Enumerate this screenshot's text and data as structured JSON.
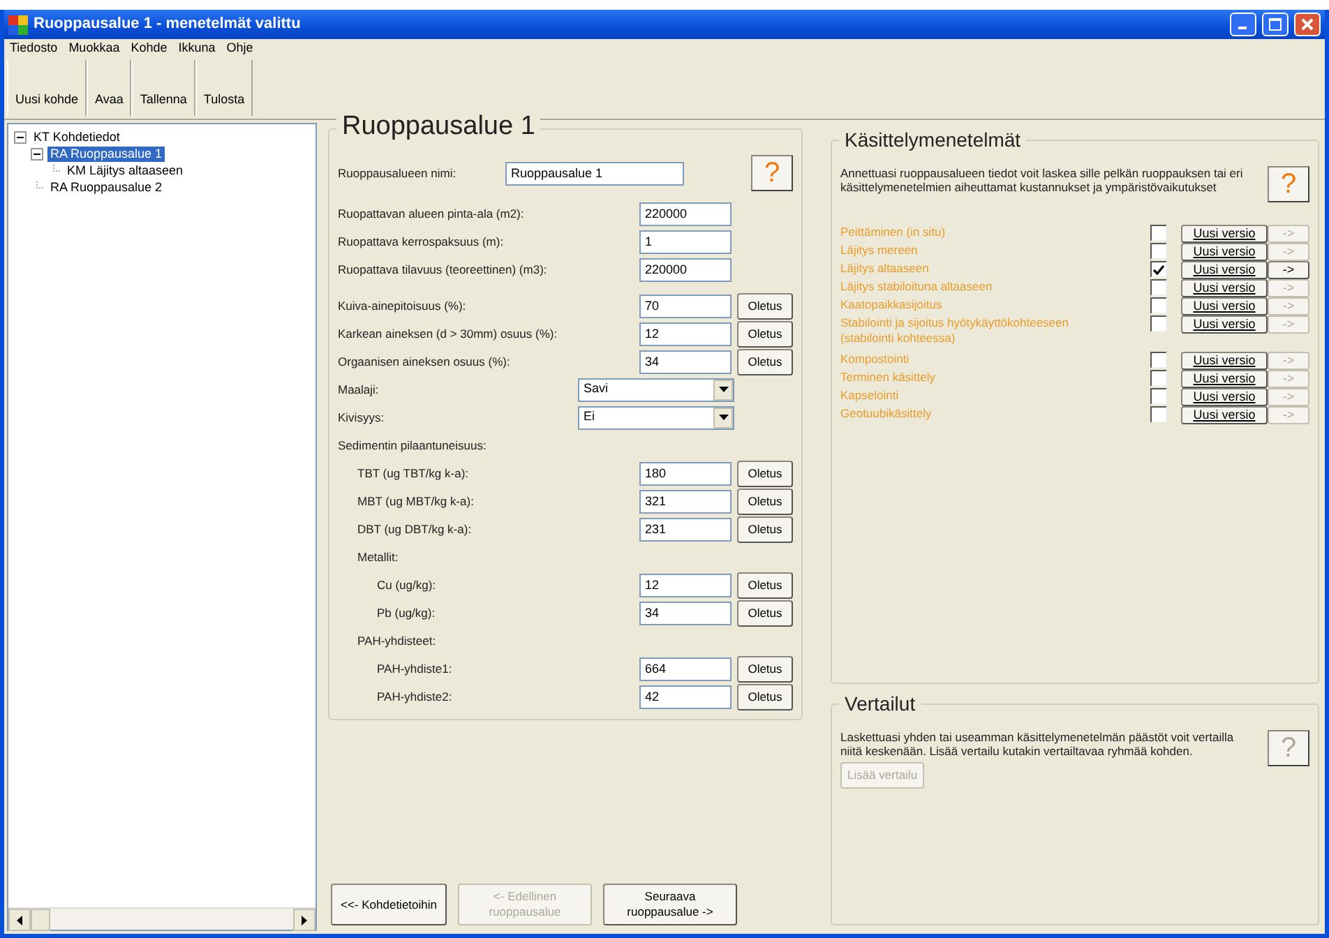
{
  "window": {
    "title": "Ruoppausalue 1 - menetelmät valittu"
  },
  "menu": [
    "Tiedosto",
    "Muokkaa",
    "Kohde",
    "Ikkuna",
    "Ohje"
  ],
  "toolbar": [
    "Uusi kohde",
    "Avaa",
    "Tallenna",
    "Tulosta"
  ],
  "tree": [
    {
      "label": "KT  Kohdetiedot",
      "expanded": true,
      "selected": false,
      "children": [
        {
          "label": "RA  Ruoppausalue 1",
          "expanded": true,
          "selected": true,
          "children": [
            {
              "label": "KM  Läjitys altaaseen",
              "selected": false
            }
          ]
        },
        {
          "label": "RA  Ruoppausalue 2",
          "selected": false
        }
      ]
    }
  ],
  "form": {
    "title": "Ruoppausalue 1",
    "help_button": {
      "label": "?",
      "disabled": false
    },
    "rows": [
      {
        "kind": "text",
        "label": "Ruoppausalueen nimi:",
        "value": "Ruoppausalue 1"
      },
      {
        "kind": "gap"
      },
      {
        "kind": "number",
        "label": "Ruopattavan alueen pinta-ala (m2):",
        "value": "220000"
      },
      {
        "kind": "number",
        "label": "Ruopattava kerrospaksuus (m):",
        "value": "1"
      },
      {
        "kind": "number",
        "label": "Ruopattava tilavuus (teoreettinen) (m3):",
        "value": "220000"
      },
      {
        "kind": "gap"
      },
      {
        "kind": "number",
        "label": "Kuiva-ainepitoisuus (%):",
        "value": "70",
        "button": "Oletus"
      },
      {
        "kind": "number",
        "label": "Karkean aineksen (d > 30mm) osuus (%):",
        "value": "12",
        "button": "Oletus"
      },
      {
        "kind": "number",
        "label": "Orgaanisen aineksen osuus (%):",
        "value": "34",
        "button": "Oletus"
      },
      {
        "kind": "select",
        "label": "Maalaji:",
        "value": "Savi"
      },
      {
        "kind": "select",
        "label": "Kivisyys:",
        "value": "Ei"
      },
      {
        "kind": "group",
        "label": "Sedimentin pilaantuneisuus:",
        "children": [
          {
            "kind": "number",
            "label": "TBT (ug TBT/kg k-a):",
            "value": "180",
            "button": "Oletus"
          },
          {
            "kind": "number",
            "label": "MBT (ug MBT/kg k-a):",
            "value": "321",
            "button": "Oletus"
          },
          {
            "kind": "number",
            "label": "DBT (ug DBT/kg k-a):",
            "value": "231",
            "button": "Oletus"
          },
          {
            "kind": "group",
            "label": "Metallit:",
            "children": [
              {
                "kind": "number",
                "label": "Cu (ug/kg):",
                "value": "12",
                "button": "Oletus"
              },
              {
                "kind": "number",
                "label": "Pb (ug/kg):",
                "value": "34",
                "button": "Oletus"
              }
            ]
          },
          {
            "kind": "group",
            "label": "PAH-yhdisteet:",
            "children": [
              {
                "kind": "number",
                "label": "PAH-yhdiste1:",
                "value": "664",
                "button": "Oletus"
              },
              {
                "kind": "number",
                "label": "PAH-yhdiste2:",
                "value": "42",
                "button": "Oletus"
              }
            ]
          }
        ]
      }
    ]
  },
  "methods_panel": {
    "title": "Käsittelymenetelmät",
    "description": "Annettuasi ruoppausalueen tiedot voit laskea sille pelkän ruoppauksen tai eri käsittelymenetelmien aiheuttamat kustannukset ja ympäristövaikutukset",
    "help_button": {
      "label": "?",
      "disabled": false
    },
    "methods": [
      {
        "label": "Peittäminen (in situ)",
        "checked": false,
        "version_button": "Uusi versio",
        "arrow_button": "->"
      },
      {
        "label": "Läjitys mereen",
        "checked": false,
        "version_button": "Uusi versio",
        "arrow_button": "->"
      },
      {
        "label": "Läjitys altaaseen",
        "checked": true,
        "version_button": "Uusi versio",
        "arrow_button": "->"
      },
      {
        "label": "Läjitys stabiloituna altaaseen",
        "checked": false,
        "version_button": "Uusi versio",
        "arrow_button": "->"
      },
      {
        "label": "Kaatopaikkasijoitus",
        "checked": false,
        "version_button": "Uusi versio",
        "arrow_button": "->"
      },
      {
        "label": "Stabilointi ja sijoitus hyötykäyttökohteeseen (stabilointi kohteessa)",
        "checked": false,
        "version_button": "Uusi versio",
        "arrow_button": "->"
      },
      {
        "label": "Kompostointi",
        "checked": false,
        "version_button": "Uusi versio",
        "arrow_button": "->"
      },
      {
        "label": "Terminen käsittely",
        "checked": false,
        "version_button": "Uusi versio",
        "arrow_button": "->"
      },
      {
        "label": "Kapselointi",
        "checked": false,
        "version_button": "Uusi versio",
        "arrow_button": "->"
      },
      {
        "label": "Geotuubikäsittely",
        "checked": false,
        "version_button": "Uusi versio",
        "arrow_button": "->"
      }
    ]
  },
  "comparisons_panel": {
    "title": "Vertailut",
    "description": "Laskettuasi yhden tai useamman käsittelymenetelmän päästöt voit vertailla niitä keskenään. Lisää vertailu kutakin vertailtavaa ryhmää kohden.",
    "help_button": {
      "label": "?",
      "disabled": true
    },
    "add_button": {
      "label": "Lisää vertailu",
      "disabled": true
    }
  },
  "nav_buttons": [
    {
      "label": "<<- Kohdetietoihin",
      "disabled": false
    },
    {
      "label": "<- Edellinen ruoppausalue",
      "disabled": true
    },
    {
      "label": "Seuraava ruoppausalue ->",
      "disabled": false
    }
  ]
}
